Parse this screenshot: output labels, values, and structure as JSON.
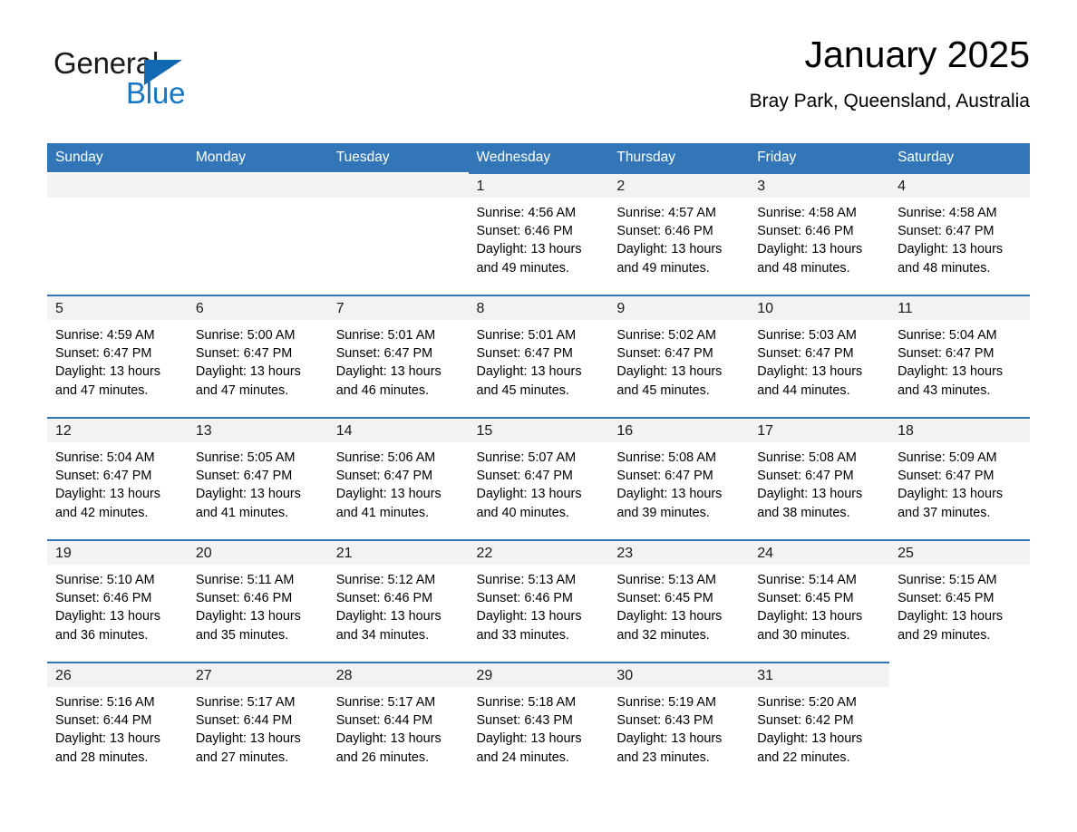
{
  "brand": {
    "name_part1": "General",
    "name_part2": "Blue",
    "triangle_color": "#1268b3",
    "blue_color": "#1577c4"
  },
  "header": {
    "title": "January 2025",
    "location": "Bray Park, Queensland, Australia"
  },
  "theme": {
    "header_bg": "#3276b8",
    "daynum_bg": "#f2f2f2",
    "row_rule": "#3276b8"
  },
  "weekday_headers": [
    "Sunday",
    "Monday",
    "Tuesday",
    "Wednesday",
    "Thursday",
    "Friday",
    "Saturday"
  ],
  "labels": {
    "sunrise_prefix": "Sunrise:",
    "sunset_prefix": "Sunset:",
    "daylight_prefix": "Daylight:"
  },
  "weeks": [
    [
      {
        "day": ""
      },
      {
        "day": ""
      },
      {
        "day": ""
      },
      {
        "day": "1",
        "sunrise": "Sunrise: 4:56 AM",
        "sunset": "Sunset: 6:46 PM",
        "daylight_line1": "Daylight: 13 hours",
        "daylight_line2": "and 49 minutes."
      },
      {
        "day": "2",
        "sunrise": "Sunrise: 4:57 AM",
        "sunset": "Sunset: 6:46 PM",
        "daylight_line1": "Daylight: 13 hours",
        "daylight_line2": "and 49 minutes."
      },
      {
        "day": "3",
        "sunrise": "Sunrise: 4:58 AM",
        "sunset": "Sunset: 6:46 PM",
        "daylight_line1": "Daylight: 13 hours",
        "daylight_line2": "and 48 minutes."
      },
      {
        "day": "4",
        "sunrise": "Sunrise: 4:58 AM",
        "sunset": "Sunset: 6:47 PM",
        "daylight_line1": "Daylight: 13 hours",
        "daylight_line2": "and 48 minutes."
      }
    ],
    [
      {
        "day": "5",
        "sunrise": "Sunrise: 4:59 AM",
        "sunset": "Sunset: 6:47 PM",
        "daylight_line1": "Daylight: 13 hours",
        "daylight_line2": "and 47 minutes."
      },
      {
        "day": "6",
        "sunrise": "Sunrise: 5:00 AM",
        "sunset": "Sunset: 6:47 PM",
        "daylight_line1": "Daylight: 13 hours",
        "daylight_line2": "and 47 minutes."
      },
      {
        "day": "7",
        "sunrise": "Sunrise: 5:01 AM",
        "sunset": "Sunset: 6:47 PM",
        "daylight_line1": "Daylight: 13 hours",
        "daylight_line2": "and 46 minutes."
      },
      {
        "day": "8",
        "sunrise": "Sunrise: 5:01 AM",
        "sunset": "Sunset: 6:47 PM",
        "daylight_line1": "Daylight: 13 hours",
        "daylight_line2": "and 45 minutes."
      },
      {
        "day": "9",
        "sunrise": "Sunrise: 5:02 AM",
        "sunset": "Sunset: 6:47 PM",
        "daylight_line1": "Daylight: 13 hours",
        "daylight_line2": "and 45 minutes."
      },
      {
        "day": "10",
        "sunrise": "Sunrise: 5:03 AM",
        "sunset": "Sunset: 6:47 PM",
        "daylight_line1": "Daylight: 13 hours",
        "daylight_line2": "and 44 minutes."
      },
      {
        "day": "11",
        "sunrise": "Sunrise: 5:04 AM",
        "sunset": "Sunset: 6:47 PM",
        "daylight_line1": "Daylight: 13 hours",
        "daylight_line2": "and 43 minutes."
      }
    ],
    [
      {
        "day": "12",
        "sunrise": "Sunrise: 5:04 AM",
        "sunset": "Sunset: 6:47 PM",
        "daylight_line1": "Daylight: 13 hours",
        "daylight_line2": "and 42 minutes."
      },
      {
        "day": "13",
        "sunrise": "Sunrise: 5:05 AM",
        "sunset": "Sunset: 6:47 PM",
        "daylight_line1": "Daylight: 13 hours",
        "daylight_line2": "and 41 minutes."
      },
      {
        "day": "14",
        "sunrise": "Sunrise: 5:06 AM",
        "sunset": "Sunset: 6:47 PM",
        "daylight_line1": "Daylight: 13 hours",
        "daylight_line2": "and 41 minutes."
      },
      {
        "day": "15",
        "sunrise": "Sunrise: 5:07 AM",
        "sunset": "Sunset: 6:47 PM",
        "daylight_line1": "Daylight: 13 hours",
        "daylight_line2": "and 40 minutes."
      },
      {
        "day": "16",
        "sunrise": "Sunrise: 5:08 AM",
        "sunset": "Sunset: 6:47 PM",
        "daylight_line1": "Daylight: 13 hours",
        "daylight_line2": "and 39 minutes."
      },
      {
        "day": "17",
        "sunrise": "Sunrise: 5:08 AM",
        "sunset": "Sunset: 6:47 PM",
        "daylight_line1": "Daylight: 13 hours",
        "daylight_line2": "and 38 minutes."
      },
      {
        "day": "18",
        "sunrise": "Sunrise: 5:09 AM",
        "sunset": "Sunset: 6:47 PM",
        "daylight_line1": "Daylight: 13 hours",
        "daylight_line2": "and 37 minutes."
      }
    ],
    [
      {
        "day": "19",
        "sunrise": "Sunrise: 5:10 AM",
        "sunset": "Sunset: 6:46 PM",
        "daylight_line1": "Daylight: 13 hours",
        "daylight_line2": "and 36 minutes."
      },
      {
        "day": "20",
        "sunrise": "Sunrise: 5:11 AM",
        "sunset": "Sunset: 6:46 PM",
        "daylight_line1": "Daylight: 13 hours",
        "daylight_line2": "and 35 minutes."
      },
      {
        "day": "21",
        "sunrise": "Sunrise: 5:12 AM",
        "sunset": "Sunset: 6:46 PM",
        "daylight_line1": "Daylight: 13 hours",
        "daylight_line2": "and 34 minutes."
      },
      {
        "day": "22",
        "sunrise": "Sunrise: 5:13 AM",
        "sunset": "Sunset: 6:46 PM",
        "daylight_line1": "Daylight: 13 hours",
        "daylight_line2": "and 33 minutes."
      },
      {
        "day": "23",
        "sunrise": "Sunrise: 5:13 AM",
        "sunset": "Sunset: 6:45 PM",
        "daylight_line1": "Daylight: 13 hours",
        "daylight_line2": "and 32 minutes."
      },
      {
        "day": "24",
        "sunrise": "Sunrise: 5:14 AM",
        "sunset": "Sunset: 6:45 PM",
        "daylight_line1": "Daylight: 13 hours",
        "daylight_line2": "and 30 minutes."
      },
      {
        "day": "25",
        "sunrise": "Sunrise: 5:15 AM",
        "sunset": "Sunset: 6:45 PM",
        "daylight_line1": "Daylight: 13 hours",
        "daylight_line2": "and 29 minutes."
      }
    ],
    [
      {
        "day": "26",
        "sunrise": "Sunrise: 5:16 AM",
        "sunset": "Sunset: 6:44 PM",
        "daylight_line1": "Daylight: 13 hours",
        "daylight_line2": "and 28 minutes."
      },
      {
        "day": "27",
        "sunrise": "Sunrise: 5:17 AM",
        "sunset": "Sunset: 6:44 PM",
        "daylight_line1": "Daylight: 13 hours",
        "daylight_line2": "and 27 minutes."
      },
      {
        "day": "28",
        "sunrise": "Sunrise: 5:17 AM",
        "sunset": "Sunset: 6:44 PM",
        "daylight_line1": "Daylight: 13 hours",
        "daylight_line2": "and 26 minutes."
      },
      {
        "day": "29",
        "sunrise": "Sunrise: 5:18 AM",
        "sunset": "Sunset: 6:43 PM",
        "daylight_line1": "Daylight: 13 hours",
        "daylight_line2": "and 24 minutes."
      },
      {
        "day": "30",
        "sunrise": "Sunrise: 5:19 AM",
        "sunset": "Sunset: 6:43 PM",
        "daylight_line1": "Daylight: 13 hours",
        "daylight_line2": "and 23 minutes."
      },
      {
        "day": "31",
        "sunrise": "Sunrise: 5:20 AM",
        "sunset": "Sunset: 6:42 PM",
        "daylight_line1": "Daylight: 13 hours",
        "daylight_line2": "and 22 minutes."
      },
      {
        "day": ""
      }
    ]
  ]
}
